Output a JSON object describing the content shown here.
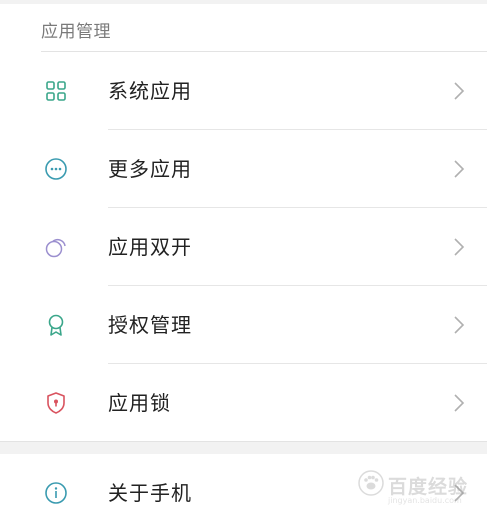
{
  "section": {
    "title": "应用管理"
  },
  "items": [
    {
      "label": "系统应用",
      "icon": "grid-icon",
      "color": "#3aa68a"
    },
    {
      "label": "更多应用",
      "icon": "more-dots-icon",
      "color": "#3a9bb0"
    },
    {
      "label": "应用双开",
      "icon": "dual-circles-icon",
      "color": "#9b8fcf"
    },
    {
      "label": "授权管理",
      "icon": "badge-icon",
      "color": "#3aa68a"
    },
    {
      "label": "应用锁",
      "icon": "shield-lock-icon",
      "color": "#d9535f"
    }
  ],
  "about": {
    "label": "关于手机",
    "icon": "info-icon",
    "color": "#3a9bb0"
  },
  "watermark": {
    "text": "百度经验",
    "url": "jingyan.baidu.com"
  }
}
